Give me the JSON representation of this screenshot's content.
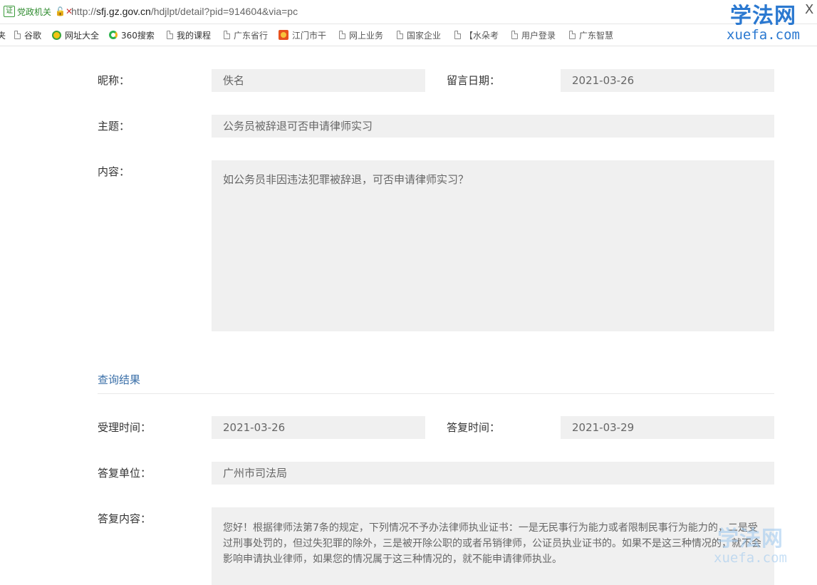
{
  "browser": {
    "cert_badge": "证",
    "cert_label": "党政机关",
    "insecure_mark": "🔓✕",
    "url_scheme": "http://",
    "url_host": "sfj.gz.gov.cn",
    "url_path": "/hdjlpt/detail?pid=914604&via=pc",
    "close_glyph": "X",
    "bookmarks": [
      {
        "label": "夹",
        "icon": "none"
      },
      {
        "label": "谷歌",
        "icon": "page-icon"
      },
      {
        "label": "网址大全",
        "icon": "navigation-icon"
      },
      {
        "label": "360搜索",
        "icon": "360-search-icon"
      },
      {
        "label": "我的课程",
        "icon": "page-icon"
      },
      {
        "label": "广东省行",
        "icon": "page-icon"
      },
      {
        "label": "江门市干",
        "icon": "guangdong-icon"
      },
      {
        "label": "网上业务",
        "icon": "page-icon"
      },
      {
        "label": "国家企业",
        "icon": "page-icon"
      },
      {
        "label": "【水朵考",
        "icon": "page-icon"
      },
      {
        "label": "用户登录",
        "icon": "page-icon"
      },
      {
        "label": "广东智慧",
        "icon": "page-icon"
      }
    ]
  },
  "watermark": {
    "cn": "学法网",
    "en": "xuefa.com"
  },
  "message": {
    "nickname_label": "昵称：",
    "nickname_value": "佚名",
    "date_label": "留言日期：",
    "date_value": "2021-03-26",
    "subject_label": "主题：",
    "subject_value": "公务员被辞退可否申请律师实习",
    "content_label": "内容：",
    "content_value": "如公务员非因违法犯罪被辞退，可否申请律师实习？"
  },
  "result": {
    "section_title": "查询结果",
    "accept_time_label": "受理时间：",
    "accept_time_value": "2021-03-26",
    "reply_time_label": "答复时间：",
    "reply_time_value": "2021-03-29",
    "reply_unit_label": "答复单位：",
    "reply_unit_value": "广州市司法局",
    "reply_content_label": "答复内容：",
    "reply_content_value": "您好！根据律师法第7条的规定，下列情况不予办法律师执业证书：一是无民事行为能力或者限制民事行为能力的，二是受过刑事处罚的，但过失犯罪的除外，三是被开除公职的或者吊销律师，公证员执业证书的。如果不是这三种情况的，就不会影响申请执业律师，如果您的情况属于这三种情况的，就不能申请律师执业。"
  },
  "colors": {
    "field_bg": "#f0f0f0",
    "section_title": "#3a6fa8",
    "watermark": "#2a78d0"
  }
}
